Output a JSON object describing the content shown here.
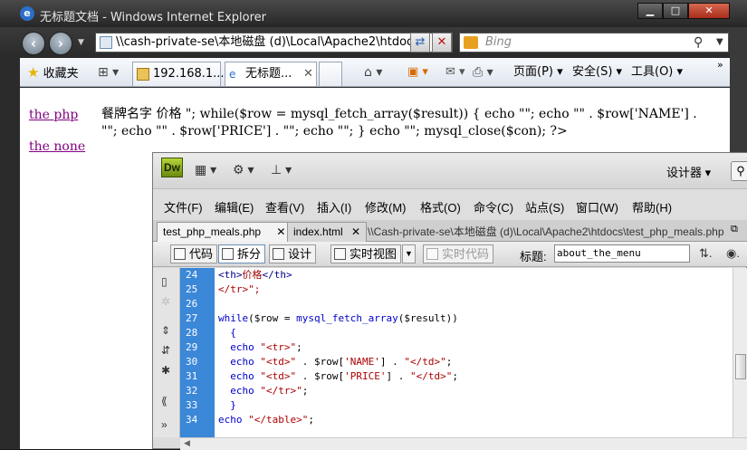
{
  "ie": {
    "title": "无标题文档 - Windows Internet Explorer",
    "address": "\\\\cash-private-se\\本地磁盘 (d)\\Local\\Apache2\\htdoc",
    "search_placeholder": "Bing",
    "favorites_label": "收藏夹",
    "tabs": [
      "192.168.1....",
      "无标题..."
    ],
    "commands": {
      "page": "页面(P)",
      "safety": "安全(S)",
      "tools": "工具(O)"
    }
  },
  "page": {
    "link1": "the php",
    "link2": "the none",
    "output_text": "餐牌名字 价格 \"; while($row = mysql_fetch_array($result)) { echo \"\"; echo \"\" . $row['NAME'] . \"\"; echo \"\" . $row['PRICE'] . \"\"; echo \"\"; } echo \"\"; mysql_close($con); ?>"
  },
  "dw": {
    "logo": "Dw",
    "designer": "设计器",
    "menu": [
      "文件(F)",
      "编辑(E)",
      "查看(V)",
      "插入(I)",
      "修改(M)",
      "格式(O)",
      "命令(C)",
      "站点(S)",
      "窗口(W)",
      "帮助(H)"
    ],
    "tabs": [
      "test_php_meals.php",
      "index.html"
    ],
    "path": "\\\\Cash-private-se\\本地磁盘 (d)\\Local\\Apache2\\htdocs\\test_php_meals.php",
    "toolbar": {
      "code": "代码",
      "split": "拆分",
      "design": "设计",
      "live_view": "实时视图",
      "live_code": "实时代码",
      "title_label": "标题:",
      "title_value": "about_the_menu"
    },
    "line_numbers": [
      "24",
      "25",
      "26",
      "27",
      "28",
      "29",
      "30",
      "31",
      "32",
      "33",
      "34"
    ],
    "code": {
      "l24_tag_open": "<th>",
      "l24_text": "价格",
      "l24_tag_close": "</th>",
      "l25": "</tr>\";",
      "l27_kw": "while",
      "l27_a": "($row = ",
      "l27_fn": "mysql_fetch_array",
      "l27_b": "($result))",
      "l28": "{",
      "l29_kw": "echo ",
      "l29_str": "\"<tr>\"",
      "l30_kw": "echo ",
      "l30_s1": "\"<td>\"",
      "l30_mid": " . $row[",
      "l30_s2": "'NAME'",
      "l30_e": "] . ",
      "l30_s3": "\"</td>\"",
      "l31_kw": "echo ",
      "l31_s1": "\"<td>\"",
      "l31_mid": " . $row[",
      "l31_s2": "'PRICE'",
      "l31_e": "] . ",
      "l31_s3": "\"</td>\"",
      "l32_kw": "echo ",
      "l32_str": "\"</tr>\"",
      "l33": "}",
      "l34_kw": "echo ",
      "l34_str": "\"</table>\""
    }
  }
}
